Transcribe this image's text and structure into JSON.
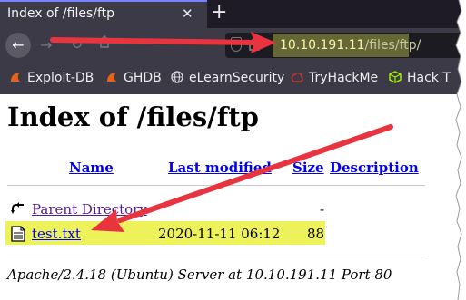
{
  "browser": {
    "tab_title": "Index of /files/ftp",
    "tab_close_glyph": "✕",
    "new_tab_glyph": "+",
    "back_glyph": "←",
    "forward_glyph": "→",
    "reload_glyph": "↻",
    "url_host": "10.10.191.11",
    "url_path": "/files/ftp/"
  },
  "bookmarks": [
    {
      "label": "Exploit-DB",
      "icon": "exploit-db-icon",
      "color": "#e8621c"
    },
    {
      "label": "GHDB",
      "icon": "ghdb-icon",
      "color": "#e8621c"
    },
    {
      "label": "eLearnSecurity",
      "icon": "globe-icon",
      "color": "#d8d8dc"
    },
    {
      "label": "TryHackMe",
      "icon": "tryhackme-icon",
      "color": "#c0392b"
    },
    {
      "label": "Hack T",
      "icon": "hackthebox-icon",
      "color": "#9fef00"
    }
  ],
  "page": {
    "heading": "Index of /files/ftp",
    "columns": {
      "name": "Name",
      "last_modified": "Last modified",
      "size": "Size",
      "description": "Description"
    },
    "rows": [
      {
        "name": "Parent Directory",
        "modified": "",
        "size": "-",
        "icon": "back-folder-icon"
      },
      {
        "name": "test.txt",
        "modified": "2020-11-11 06:12",
        "size": "88",
        "icon": "text-file-icon"
      }
    ],
    "footer": "Apache/2.4.18 (Ubuntu) Server at 10.10.191.11 Port 80"
  },
  "colors": {
    "annotation_arrow": "#e8343f",
    "highlight": "#eef25a",
    "link": "#0000ee",
    "visited_link": "#551a8b"
  }
}
